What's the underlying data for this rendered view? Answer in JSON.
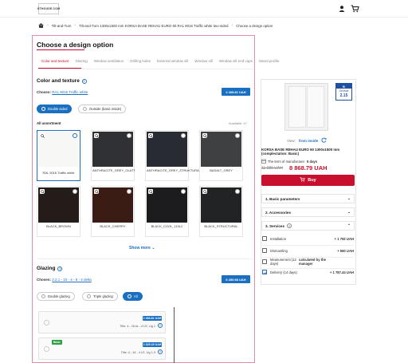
{
  "header": {
    "logo_text": "GTHOUSE.COM",
    "user_icon": "user-icon",
    "cart_icon": "cart-icon"
  },
  "breadcrumb": {
    "home_icon": "home-icon",
    "items": [
      "Tilt-and-Turn",
      "Tilt-and-Turn 1300x1500 mm KORSA BASE REHAU EURO 60 RAL 9016 Traffic white two-sided",
      "Choose a design option"
    ]
  },
  "main": {
    "title": "Choose a design option",
    "tabs": [
      {
        "label": "Color and texture",
        "active": true
      },
      {
        "label": "Glazing"
      },
      {
        "label": "Window ventilation"
      },
      {
        "label": "Drilling holes"
      },
      {
        "label": "External window sill"
      },
      {
        "label": "Window sill"
      },
      {
        "label": "Window sill end caps"
      },
      {
        "label": "Stand profile"
      }
    ]
  },
  "color": {
    "section_title": "Color and texture",
    "chosen_label": "Chosen:",
    "chosen_value": "RAL 9016 Traffic white",
    "price": "2 408.81 UAH",
    "options": [
      {
        "label": "Double sided",
        "selected": true
      },
      {
        "label": "Outside (basic inside)",
        "selected": false
      }
    ],
    "assortment_label": "All assortment",
    "available_label": "Available: 47",
    "swatches": [
      {
        "name": "RAL 9016 Traffic white",
        "color": "#f7f8f6",
        "selected": true
      },
      {
        "name": "ANTHRACITE_GREY_OLATT",
        "color": "#2f3134",
        "selected": false
      },
      {
        "name": "ANTHRACITE_GREY_STRUKTURAL",
        "color": "#282b31",
        "selected": false
      },
      {
        "name": "BASALT_GREY",
        "color": "#3e4042",
        "selected": false
      },
      {
        "name": "BLACK_BROWN",
        "color": "#231c19",
        "selected": false
      },
      {
        "name": "BLACK_CHERRY",
        "color": "#3a1c14",
        "selected": false
      },
      {
        "name": "BLACK_COOL_110L2",
        "color": "#1c1c1e",
        "selected": false
      },
      {
        "name": "BLACK_STRUCTURAL",
        "color": "#222324",
        "selected": false
      }
    ],
    "show_more": "Show more"
  },
  "glazing": {
    "section_title": "Glazing",
    "chosen_label": "Chosen:",
    "chosen_value": "2.2.1 - 10 - 4 - 8 - 4 delta",
    "price": "6 459.98 UAH",
    "options": [
      {
        "label": "Double glazing",
        "selected": false
      },
      {
        "label": "Triple glazing",
        "selected": false
      },
      {
        "label": "All",
        "selected": true
      }
    ],
    "cards": [
      {
        "price": "2 383.81 UAH",
        "title": "Title: 4 - 16 Ar - 4 LE, Ug 1",
        "badge": ""
      },
      {
        "price": "2 325.43 UAH",
        "title": "Title: 4 - 16 - 4 LE, Ug 1.3",
        "badge": "Basic"
      }
    ]
  },
  "summary": {
    "gerv_top": "B",
    "gerv_label": "Gerviale",
    "gerv_value": "2.15",
    "view_label": "View:",
    "view_value": "from inside",
    "product_name": "KORSA BASE REHAU EURO 60 1300x1500 mm (complectation: Basic)",
    "term_label": "The term of manufacture:",
    "term_value": "5 days",
    "old_price": "11 086 UAH",
    "new_price": "8 868.79 UAH",
    "buy_label": "Buy",
    "accordions": [
      {
        "label": "1. Basic parameters"
      },
      {
        "label": "2. Accessories"
      },
      {
        "label": "3. Services"
      }
    ],
    "services": [
      {
        "name": "Installation",
        "price": "+ 1 792 UAH",
        "checked": false
      },
      {
        "name": "Dismantling",
        "price": "+ 560 UAH",
        "checked": false
      },
      {
        "name": "Measurement (12 days)",
        "price": "calculated by the manager",
        "checked": false
      },
      {
        "name": "Delivery (14 days)",
        "price": "+ 1 787.44 UAH",
        "checked": true
      }
    ]
  }
}
